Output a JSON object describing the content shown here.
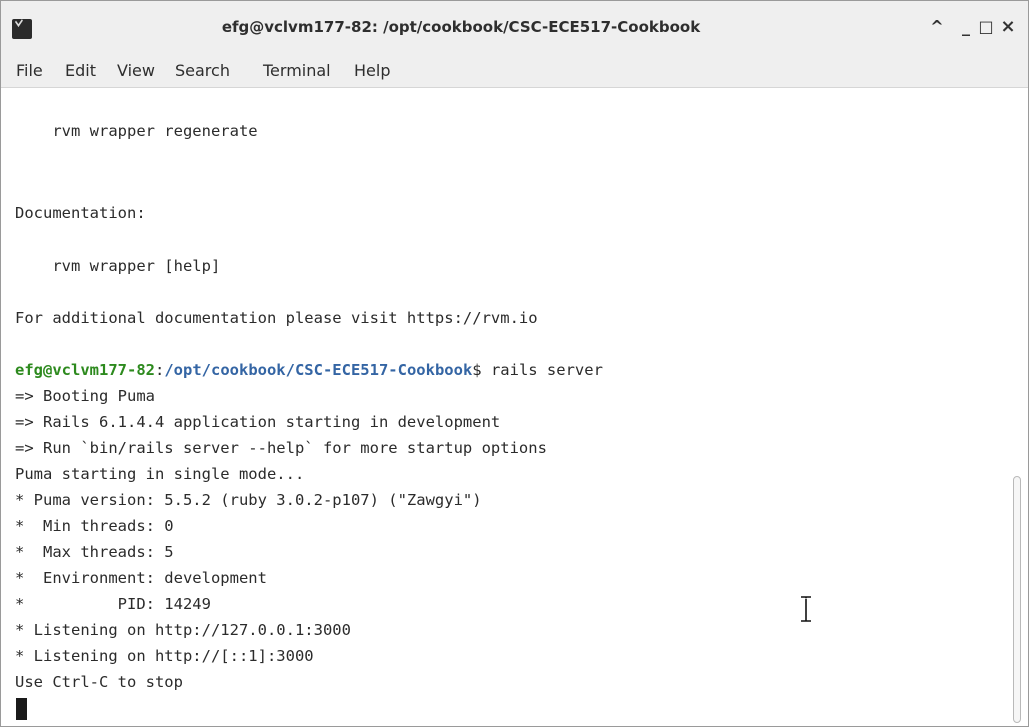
{
  "window": {
    "title": "efg@vclvm177-82: /opt/cookbook/CSC-ECE517-Cookbook",
    "controls": {
      "maximize_glyph": "^",
      "minimize_glyph": "_",
      "restore_glyph": "□",
      "close_glyph": "×"
    }
  },
  "menu": [
    "File",
    "Edit",
    "View",
    "Search",
    "Terminal",
    "Help"
  ],
  "terminal": {
    "lines_top": [
      "    rvm wrapper regenerate",
      "Documentation:",
      "    rvm wrapper [help]",
      "For additional documentation please visit https://rvm.io"
    ],
    "prompt": {
      "user_host": "efg@vclvm177-82",
      "colon": ":",
      "path": "/opt/cookbook/CSC-ECE517-Cookbook",
      "suffix": "$ rails server"
    },
    "output": [
      "=> Booting Puma",
      "=> Rails 6.1.4.4 application starting in development",
      "=> Run `bin/rails server --help` for more startup options",
      "Puma starting in single mode...",
      "* Puma version: 5.5.2 (ruby 3.0.2-p107) (\"Zawgyi\")",
      "*  Min threads: 0",
      "*  Max threads: 5",
      "*  Environment: development",
      "*          PID: 14249",
      "* Listening on http://127.0.0.1:3000",
      "* Listening on http://[::1]:3000",
      "Use Ctrl-C to stop"
    ]
  },
  "icons": {
    "app": "terminal-icon",
    "mouse_cursor": "text-ibeam-icon"
  },
  "colors": {
    "prompt_user": "#2d8a1e",
    "prompt_path": "#3465a4"
  }
}
